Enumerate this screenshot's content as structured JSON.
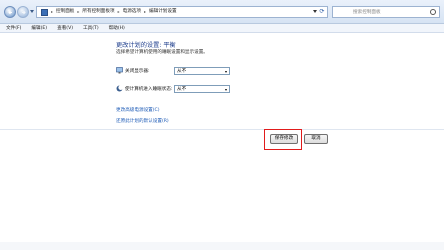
{
  "address_bar": {
    "crumbs": [
      "控制面板",
      "所有控制面板项",
      "电源选项",
      "编辑计划设置"
    ],
    "search_placeholder": "搜索控制面板"
  },
  "menu": [
    "文件(F)",
    "编辑(E)",
    "查看(V)",
    "工具(T)",
    "帮助(H)"
  ],
  "page": {
    "title": "更改计划的设置: 平衡",
    "subtitle": "选择希望计算机使用的睡眠设置和显示设置。",
    "settings": [
      {
        "label": "关闭显示器:",
        "value": "从不"
      },
      {
        "label": "使计算机进入睡眠状态:",
        "value": "从不"
      }
    ],
    "links": {
      "advanced": "更改高级电源设置(C)",
      "restore": "还原此计划的默认设置(R)"
    },
    "buttons": {
      "save": "保存修改",
      "cancel": "取消"
    }
  },
  "colors": {
    "highlight": "#e11b1b",
    "link": "#1c5ab6",
    "title": "#1d3d8c"
  }
}
